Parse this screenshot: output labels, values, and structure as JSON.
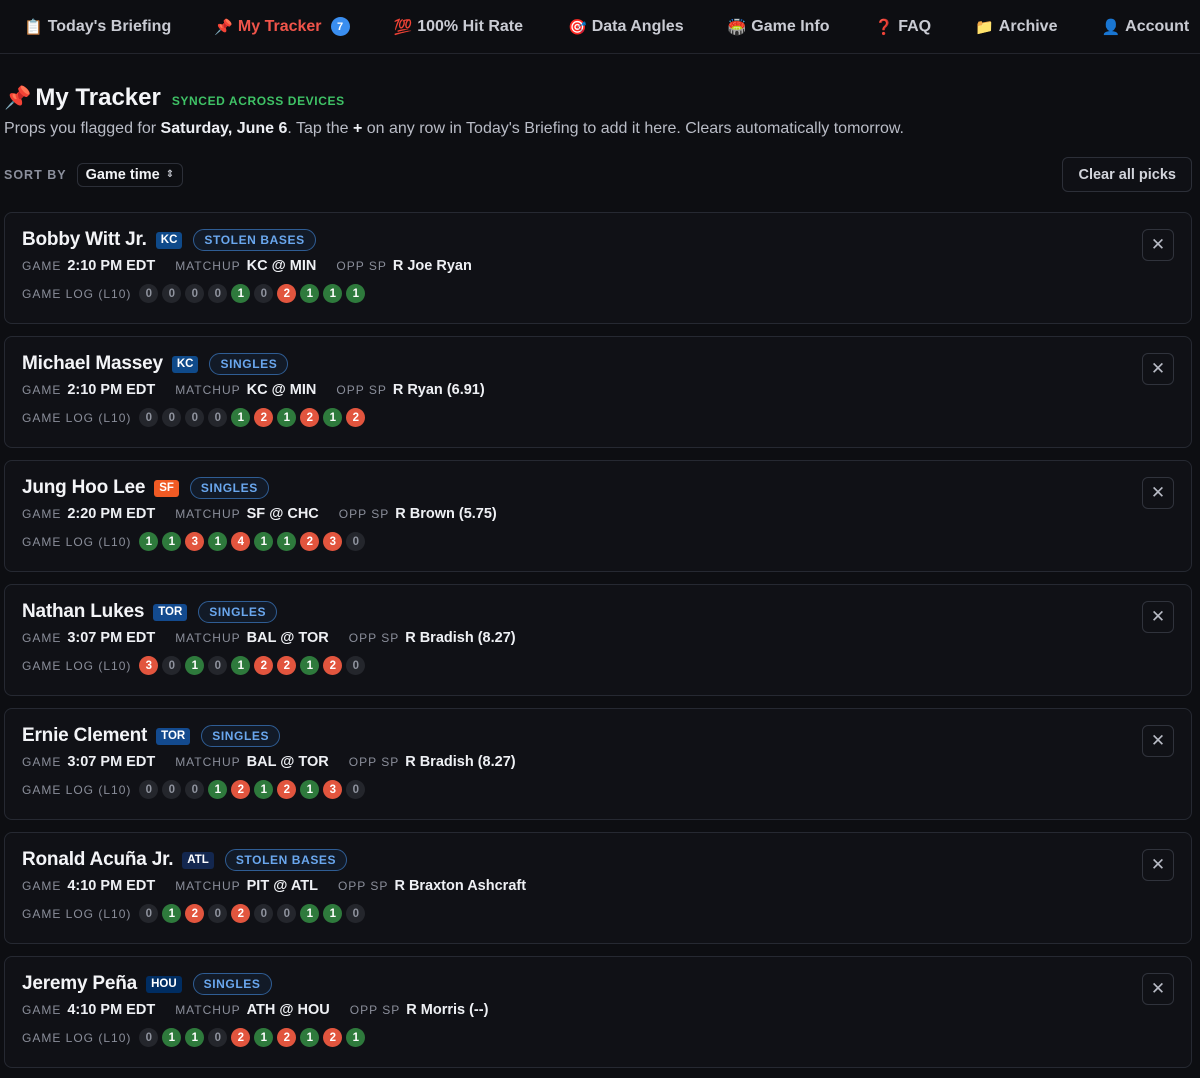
{
  "nav": [
    {
      "emoji": "📋",
      "label": "Today's Briefing",
      "active": false
    },
    {
      "emoji": "📌",
      "label": "My Tracker",
      "active": true,
      "badge": "7"
    },
    {
      "emoji": "💯",
      "label": "100% Hit Rate",
      "active": false
    },
    {
      "emoji": "🎯",
      "label": "Data Angles",
      "active": false
    },
    {
      "emoji": "🏟️",
      "label": "Game Info",
      "active": false
    },
    {
      "emoji": "❓",
      "label": "FAQ",
      "active": false
    },
    {
      "emoji": "📁",
      "label": "Archive",
      "active": false
    },
    {
      "emoji": "👤",
      "label": "Account",
      "active": false
    }
  ],
  "header": {
    "icon": "📌",
    "title": "My Tracker",
    "synced": "SYNCED ACROSS DEVICES",
    "desc_pre": "Props you flagged for ",
    "desc_date": "Saturday, June 6",
    "desc_mid": ". Tap the ",
    "desc_plus": "+",
    "desc_post": " on any row in Today's Briefing to add it here. Clears automatically tomorrow."
  },
  "sort": {
    "label": "SORT BY",
    "value": "Game time",
    "caret": "⌃⌄"
  },
  "clear_label": "Clear all picks",
  "labels": {
    "game": "GAME",
    "matchup": "MATCHUP",
    "opp": "OPP SP",
    "log": "GAME LOG (L10)",
    "close": "✕"
  },
  "colors": {
    "KC": "#0f4a8a",
    "SF": "#f05a24",
    "TOR": "#134a8e",
    "ATL": "#13274f",
    "HOU": "#002d62"
  },
  "cards": [
    {
      "name": "Bobby Witt Jr.",
      "team": "KC",
      "prop": "STOLEN BASES",
      "time": "2:10 PM EDT",
      "matchup": "KC @ MIN",
      "opp": "R Joe Ryan",
      "log": [
        0,
        0,
        0,
        0,
        1,
        0,
        2,
        1,
        1,
        1
      ]
    },
    {
      "name": "Michael Massey",
      "team": "KC",
      "prop": "SINGLES",
      "time": "2:10 PM EDT",
      "matchup": "KC @ MIN",
      "opp": "R Ryan (6.91)",
      "log": [
        0,
        0,
        0,
        0,
        1,
        2,
        1,
        2,
        1,
        2
      ]
    },
    {
      "name": "Jung Hoo Lee",
      "team": "SF",
      "prop": "SINGLES",
      "time": "2:20 PM EDT",
      "matchup": "SF @ CHC",
      "opp": "R Brown (5.75)",
      "log": [
        1,
        1,
        3,
        1,
        4,
        1,
        1,
        2,
        3,
        0
      ]
    },
    {
      "name": "Nathan Lukes",
      "team": "TOR",
      "prop": "SINGLES",
      "time": "3:07 PM EDT",
      "matchup": "BAL @ TOR",
      "opp": "R Bradish (8.27)",
      "log": [
        3,
        0,
        1,
        0,
        1,
        2,
        2,
        1,
        2,
        0
      ]
    },
    {
      "name": "Ernie Clement",
      "team": "TOR",
      "prop": "SINGLES",
      "time": "3:07 PM EDT",
      "matchup": "BAL @ TOR",
      "opp": "R Bradish (8.27)",
      "log": [
        0,
        0,
        0,
        1,
        2,
        1,
        2,
        1,
        3,
        0
      ]
    },
    {
      "name": "Ronald Acuña Jr.",
      "team": "ATL",
      "prop": "STOLEN BASES",
      "time": "4:10 PM EDT",
      "matchup": "PIT @ ATL",
      "opp": "R Braxton Ashcraft",
      "log": [
        0,
        1,
        2,
        0,
        2,
        0,
        0,
        1,
        1,
        0
      ]
    },
    {
      "name": "Jeremy Peña",
      "team": "HOU",
      "prop": "SINGLES",
      "time": "4:10 PM EDT",
      "matchup": "ATH @ HOU",
      "opp": "R Morris (--)",
      "log": [
        0,
        1,
        1,
        0,
        2,
        1,
        2,
        1,
        2,
        1
      ]
    }
  ]
}
